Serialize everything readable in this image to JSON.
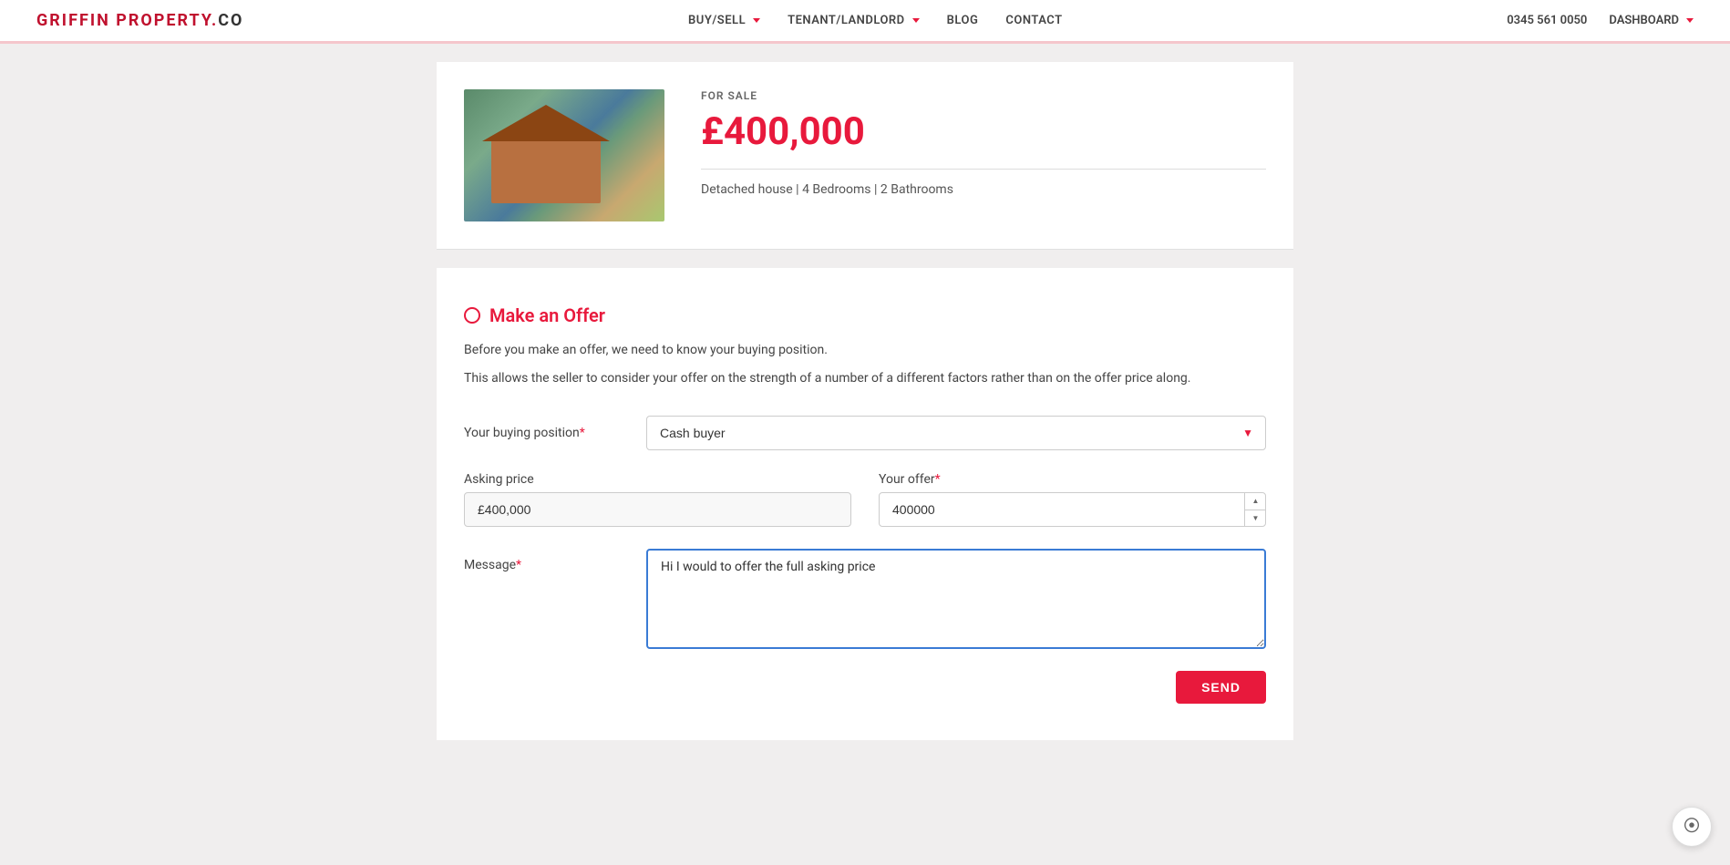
{
  "brand": {
    "name_part1": "GRIFFIN PROPERTY.",
    "name_part2": "Co"
  },
  "nav": {
    "links": [
      {
        "label": "BUY/SELL",
        "has_dropdown": true
      },
      {
        "label": "TENANT/LANDLORD",
        "has_dropdown": true
      },
      {
        "label": "BLOG",
        "has_dropdown": false
      },
      {
        "label": "CONTACT",
        "has_dropdown": false
      }
    ],
    "phone": "0345 561 0050",
    "dashboard_label": "DASHBOARD"
  },
  "property": {
    "status": "FOR SALE",
    "price": "£400,000",
    "details": "Detached house | 4 Bedrooms | 2 Bathrooms"
  },
  "form": {
    "title": "Make an Offer",
    "desc1": "Before you make an offer, we need to know your buying position.",
    "desc2": "This allows the seller to consider your offer on the strength of a number of a different factors rather than on the offer price along.",
    "buying_position_label": "Your buying position",
    "buying_position_value": "Cash buyer",
    "asking_price_label": "Asking price",
    "asking_price_value": "£400,000",
    "your_offer_label": "Your offer",
    "your_offer_value": "400000",
    "message_label": "Message",
    "message_value": "Hi I would to offer the full asking price",
    "send_label": "SEND"
  }
}
